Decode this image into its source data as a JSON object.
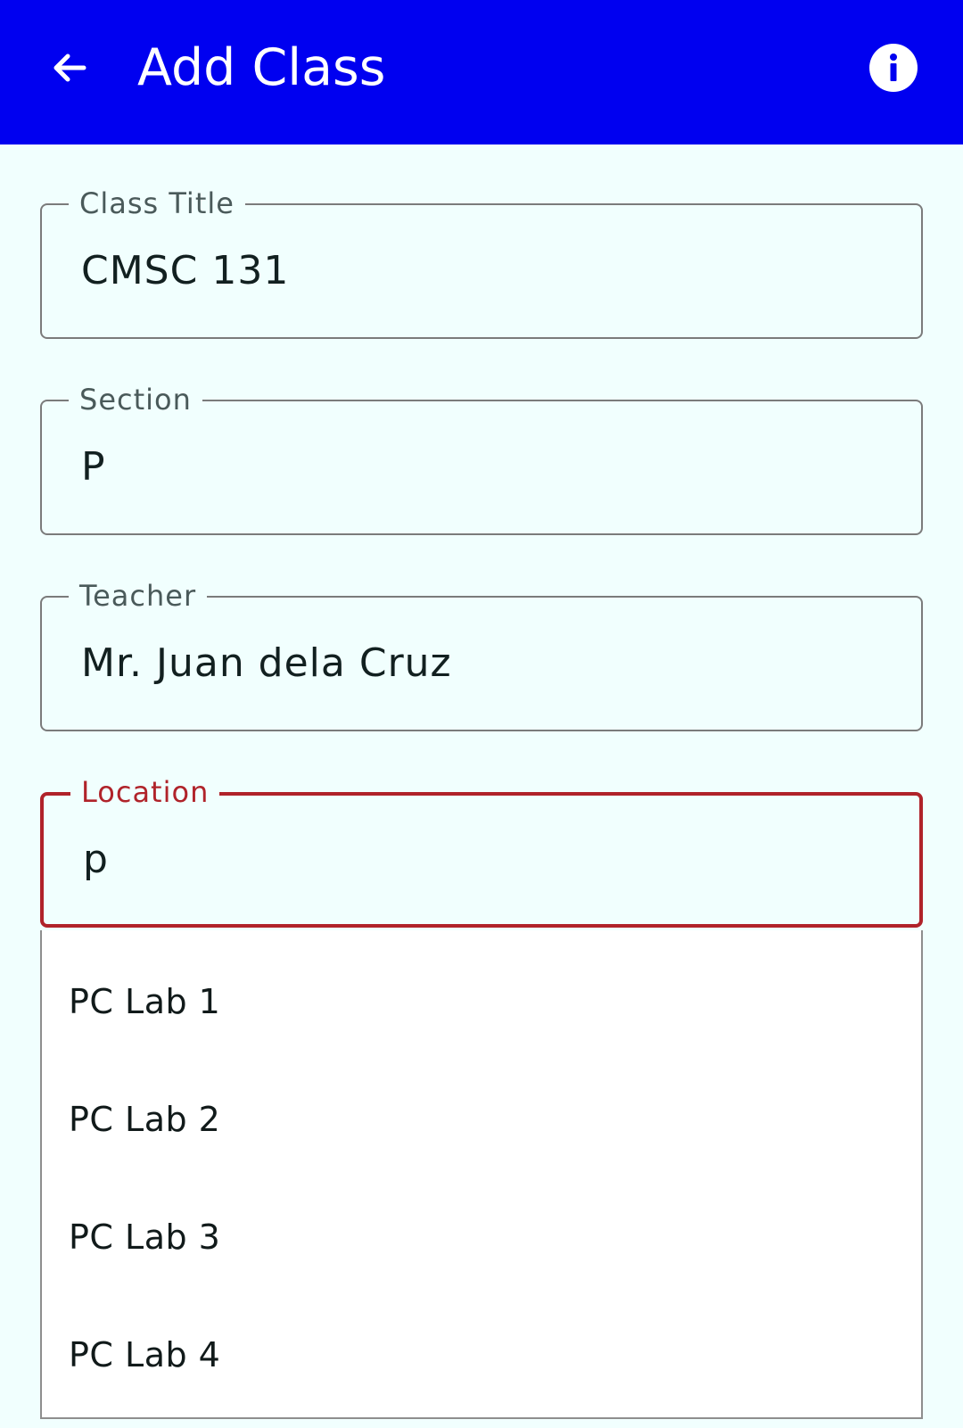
{
  "appbar": {
    "title": "Add Class",
    "back_icon": "arrow-back-icon",
    "info_icon": "info-icon",
    "color": "#0000f0"
  },
  "form": {
    "class_title": {
      "label": "Class Title",
      "value": "CMSC 131"
    },
    "section": {
      "label": "Section",
      "value": "P"
    },
    "teacher": {
      "label": "Teacher",
      "value": "Mr. Juan dela Cruz"
    },
    "location": {
      "label": "Location",
      "value": "p",
      "accent_color": "#b0232a"
    }
  },
  "location_suggestions": [
    "PC Lab 1",
    "PC Lab 2",
    "PC Lab 3",
    "PC Lab 4"
  ],
  "colors": {
    "background": "#f1fffe",
    "focused": "#b0232a"
  }
}
